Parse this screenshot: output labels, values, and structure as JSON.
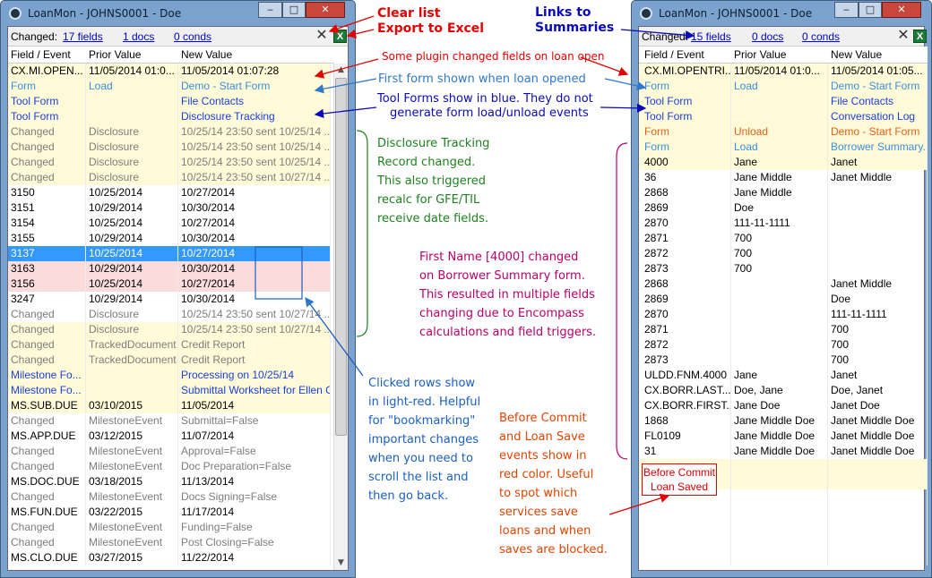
{
  "left": {
    "title": "LoanMon - JOHNS0001 - Doe",
    "changed_label": "Changed:",
    "links": [
      "17 fields",
      "1 docs",
      "0 conds"
    ],
    "columns": [
      "Field / Event",
      "Prior Value",
      "New Value"
    ],
    "rows": [
      {
        "t": "y",
        "k": "k",
        "c": [
          "CX.MI.OPEN...",
          "11/05/2014 01:0...",
          "11/05/2014 01:07:28"
        ]
      },
      {
        "t": "y",
        "k": "lb",
        "c": [
          "Form",
          "Load",
          "Demo - Start Form"
        ]
      },
      {
        "t": "y",
        "k": "blue",
        "c": [
          "Tool Form",
          "",
          "File Contacts"
        ]
      },
      {
        "t": "y",
        "k": "blue",
        "c": [
          "Tool Form",
          "",
          "Disclosure Tracking"
        ]
      },
      {
        "t": "y",
        "k": "g",
        "c": [
          "Changed",
          "Disclosure",
          "10/25/14 23:50 sent 10/25/14 ..."
        ]
      },
      {
        "t": "y",
        "k": "g",
        "c": [
          "Changed",
          "Disclosure",
          "10/25/14 23:50 sent 10/25/14 ..."
        ]
      },
      {
        "t": "y",
        "k": "g",
        "c": [
          "Changed",
          "Disclosure",
          "10/25/14 23:50 sent 10/25/14 ..."
        ]
      },
      {
        "t": "y",
        "k": "g",
        "c": [
          "Changed",
          "Disclosure",
          "10/25/14 23:50 sent 10/27/14 ..."
        ]
      },
      {
        "t": "w",
        "k": "k",
        "c": [
          "3150",
          "10/25/2014",
          "10/27/2014"
        ]
      },
      {
        "t": "w",
        "k": "k",
        "c": [
          "3151",
          "10/29/2014",
          "10/30/2014"
        ]
      },
      {
        "t": "w",
        "k": "k",
        "c": [
          "3154",
          "10/25/2014",
          "10/27/2014"
        ]
      },
      {
        "t": "w",
        "k": "k",
        "c": [
          "3155",
          "10/29/2014",
          "10/30/2014"
        ]
      },
      {
        "t": "s",
        "k": "k",
        "c": [
          "3137",
          "10/25/2014",
          "10/27/2014"
        ]
      },
      {
        "t": "p",
        "k": "k",
        "c": [
          "3163",
          "10/29/2014",
          "10/30/2014"
        ]
      },
      {
        "t": "p",
        "k": "k",
        "c": [
          "3156",
          "10/25/2014",
          "10/27/2014"
        ]
      },
      {
        "t": "w",
        "k": "k",
        "c": [
          "3247",
          "10/29/2014",
          "10/30/2014"
        ]
      },
      {
        "t": "w",
        "k": "g",
        "c": [
          "Changed",
          "Disclosure",
          "10/25/14 23:50 sent 10/27/14 ..."
        ]
      },
      {
        "t": "y",
        "k": "g",
        "c": [
          "Changed",
          "Disclosure",
          "10/25/14 23:50 sent 10/27/14 ..."
        ]
      },
      {
        "t": "y",
        "k": "g",
        "c": [
          "Changed",
          "TrackedDocument",
          "Credit Report"
        ]
      },
      {
        "t": "y",
        "k": "g",
        "c": [
          "Changed",
          "TrackedDocument",
          "Credit Report"
        ]
      },
      {
        "t": "y",
        "k": "blue",
        "c": [
          "Milestone Fo...",
          "",
          "Processing on 10/25/14"
        ]
      },
      {
        "t": "y",
        "k": "blue",
        "c": [
          "Milestone Fo...",
          "",
          "Submittal Worksheet  for Ellen G..."
        ]
      },
      {
        "t": "y",
        "k": "k",
        "c": [
          "MS.SUB.DUE",
          "03/10/2015",
          "11/05/2014"
        ]
      },
      {
        "t": "w",
        "k": "g",
        "c": [
          "Changed",
          "MilestoneEvent",
          "Submittal=False"
        ]
      },
      {
        "t": "w",
        "k": "k",
        "c": [
          "MS.APP.DUE",
          "03/12/2015",
          "11/07/2014"
        ]
      },
      {
        "t": "w",
        "k": "g",
        "c": [
          "Changed",
          "MilestoneEvent",
          "Approval=False"
        ]
      },
      {
        "t": "w",
        "k": "g",
        "c": [
          "Changed",
          "MilestoneEvent",
          "Doc Preparation=False"
        ]
      },
      {
        "t": "w",
        "k": "k",
        "c": [
          "MS.DOC.DUE",
          "03/18/2015",
          "11/13/2014"
        ]
      },
      {
        "t": "w",
        "k": "g",
        "c": [
          "Changed",
          "MilestoneEvent",
          "Docs Signing=False"
        ]
      },
      {
        "t": "w",
        "k": "k",
        "c": [
          "MS.FUN.DUE",
          "03/22/2015",
          "11/17/2014"
        ]
      },
      {
        "t": "w",
        "k": "g",
        "c": [
          "Changed",
          "MilestoneEvent",
          "Funding=False"
        ]
      },
      {
        "t": "w",
        "k": "g",
        "c": [
          "Changed",
          "MilestoneEvent",
          "Post Closing=False"
        ]
      },
      {
        "t": "w",
        "k": "k",
        "c": [
          "MS.CLO.DUE",
          "03/27/2015",
          "11/22/2014"
        ]
      }
    ]
  },
  "right": {
    "title": "LoanMon - JOHNS0001 - Doe",
    "changed_label": "Changed:",
    "links": [
      "15 fields",
      "0 docs",
      "0 conds"
    ],
    "columns": [
      "Field / Event",
      "Prior Value",
      "New Value"
    ],
    "rows": [
      {
        "t": "y",
        "k": "k",
        "c": [
          "CX.MI.OPENTRI...",
          "11/05/2014 01:0...",
          "11/05/2014 01:05..."
        ]
      },
      {
        "t": "y",
        "k": "lb",
        "c": [
          "Form",
          "Load",
          "Demo - Start Form"
        ]
      },
      {
        "t": "y",
        "k": "blue",
        "c": [
          "Tool Form",
          "",
          "File Contacts"
        ]
      },
      {
        "t": "y",
        "k": "blue",
        "c": [
          "Tool Form",
          "",
          "Conversation Log"
        ]
      },
      {
        "t": "y",
        "k": "rd",
        "c": [
          "Form",
          "Unload",
          "Demo - Start Form"
        ]
      },
      {
        "t": "y",
        "k": "lb",
        "c": [
          "Form",
          "Load",
          "Borrower Summary..."
        ]
      },
      {
        "t": "y",
        "k": "k",
        "c": [
          "4000",
          "Jane",
          "Janet"
        ]
      },
      {
        "t": "w",
        "k": "k",
        "c": [
          "36",
          "Jane Middle",
          "Janet Middle"
        ]
      },
      {
        "t": "w",
        "k": "k",
        "c": [
          "2868",
          "Jane Middle",
          ""
        ]
      },
      {
        "t": "w",
        "k": "k",
        "c": [
          "2869",
          "Doe",
          ""
        ]
      },
      {
        "t": "w",
        "k": "k",
        "c": [
          "2870",
          "111-11-1111",
          ""
        ]
      },
      {
        "t": "w",
        "k": "k",
        "c": [
          "2871",
          "700",
          ""
        ]
      },
      {
        "t": "w",
        "k": "k",
        "c": [
          "2872",
          "700",
          ""
        ]
      },
      {
        "t": "w",
        "k": "k",
        "c": [
          "2873",
          "700",
          ""
        ]
      },
      {
        "t": "w",
        "k": "k",
        "c": [
          "2868",
          "",
          "Janet Middle"
        ]
      },
      {
        "t": "w",
        "k": "k",
        "c": [
          "2869",
          "",
          "Doe"
        ]
      },
      {
        "t": "w",
        "k": "k",
        "c": [
          "2870",
          "",
          "111-11-1111"
        ]
      },
      {
        "t": "w",
        "k": "k",
        "c": [
          "2871",
          "",
          "700"
        ]
      },
      {
        "t": "w",
        "k": "k",
        "c": [
          "2872",
          "",
          "700"
        ]
      },
      {
        "t": "w",
        "k": "k",
        "c": [
          "2873",
          "",
          "700"
        ]
      },
      {
        "t": "w",
        "k": "k",
        "c": [
          "ULDD.FNM.4000",
          "Jane",
          "Janet"
        ]
      },
      {
        "t": "w",
        "k": "k",
        "c": [
          "CX.BORR.LAST...",
          "Doe, Jane",
          "Doe, Janet"
        ]
      },
      {
        "t": "w",
        "k": "k",
        "c": [
          "CX.BORR.FIRST...",
          "Jane Doe",
          "Janet Doe"
        ]
      },
      {
        "t": "w",
        "k": "k",
        "c": [
          "1868",
          "Jane Middle Doe",
          "Janet Middle Doe"
        ]
      },
      {
        "t": "w",
        "k": "k",
        "c": [
          "FL0109",
          "Jane Middle Doe",
          "Janet Middle Doe"
        ]
      },
      {
        "t": "w",
        "k": "k",
        "c": [
          "31",
          "Jane Middle Doe",
          "Janet Middle Doe"
        ]
      },
      {
        "t": "y",
        "k": "k",
        "c": [
          "",
          "",
          ""
        ]
      },
      {
        "t": "y",
        "k": "k",
        "c": [
          "",
          "",
          ""
        ]
      },
      {
        "t": "w",
        "k": "k",
        "c": [
          "",
          "",
          ""
        ]
      },
      {
        "t": "w",
        "k": "k",
        "c": [
          "",
          "",
          ""
        ]
      },
      {
        "t": "w",
        "k": "k",
        "c": [
          "",
          "",
          ""
        ]
      },
      {
        "t": "w",
        "k": "k",
        "c": [
          "",
          "",
          ""
        ]
      },
      {
        "t": "w",
        "k": "k",
        "c": [
          "",
          "",
          ""
        ]
      }
    ],
    "before_commit": [
      "Before Commit",
      "Loan Saved"
    ]
  },
  "callouts": {
    "clear_list": "Clear list",
    "export_excel": "Export to Excel",
    "links_summaries": [
      "Links to",
      "Summaries"
    ],
    "plugin_fields": "Some plugin changed fields on loan open",
    "first_form": "First form shown when loan opened",
    "tool_forms": [
      "Tool Forms show in blue.  They do not",
      "generate form load/unload events"
    ],
    "disclosure": [
      "Disclosure Tracking",
      "Record changed.",
      "This also triggered",
      "recalc for GFE/TIL",
      "receive date fields."
    ],
    "first_name": [
      "First Name [4000] changed",
      "on Borrower Summary form.",
      "This resulted in multiple fields",
      "changing due to Encompass",
      "calculations and field triggers."
    ],
    "clicked_rows": [
      "Clicked rows show",
      "in light-red.  Helpful",
      "for \"bookmarking\"",
      "important changes",
      "when you need to",
      "scroll the list and",
      "then go back."
    ],
    "before_commit_note": [
      "Before Commit",
      "and Loan Save",
      "events show in",
      "red color.  Useful",
      "to spot which",
      "services save",
      "loans and when",
      "saves are blocked."
    ]
  },
  "colors": {
    "clicked_row": "#fadcdc",
    "selected_row": "#3399ff",
    "tool_form": "#1a3fd8",
    "event_row": "#fffbd8"
  },
  "icons": [
    "app-icon",
    "clear-list-icon",
    "excel-icon"
  ]
}
